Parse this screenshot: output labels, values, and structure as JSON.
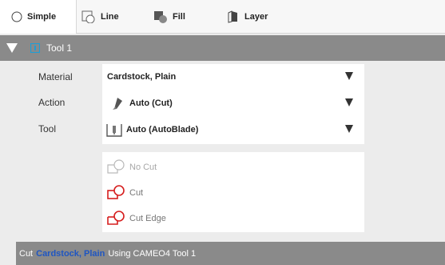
{
  "tabs": [
    {
      "label": "Simple",
      "icon": "radio-circle-icon",
      "active": true
    },
    {
      "label": "Line",
      "icon": "line-outline-icon",
      "active": false
    },
    {
      "label": "Fill",
      "icon": "fill-shape-icon",
      "active": false
    },
    {
      "label": "Layer",
      "icon": "layer-icon",
      "active": false
    }
  ],
  "tool_header": {
    "label": "Tool 1",
    "expand_icon": "triangle-down-icon",
    "tool_icon": "tool-number-icon"
  },
  "settings": {
    "material": {
      "label": "Material",
      "value": "Cardstock, Plain"
    },
    "action": {
      "label": "Action",
      "value": "Auto (Cut)",
      "icon": "knife-icon"
    },
    "tool": {
      "label": "Tool",
      "value": "Auto (AutoBlade)",
      "icon": "blade-holder-icon"
    }
  },
  "actions": [
    {
      "label": "No Cut",
      "icon": "no-cut-icon",
      "state": "disabled"
    },
    {
      "label": "Cut",
      "icon": "cut-icon",
      "state": "enabled"
    },
    {
      "label": "Cut Edge",
      "icon": "cut-edge-icon",
      "state": "enabled"
    }
  ],
  "status": {
    "prefix": "Cut",
    "material": "Cardstock, Plain",
    "suffix": "Using CAMEO4 Tool 1"
  },
  "colors": {
    "accent_red": "#d61e1e",
    "link_blue": "#1f56c2",
    "header_gray": "#8a8a8a",
    "tool_cyan": "#1e9ed6"
  }
}
